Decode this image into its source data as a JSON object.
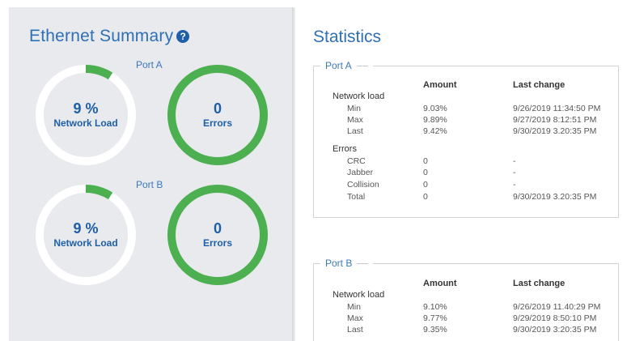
{
  "summary": {
    "title": "Ethernet Summary",
    "help_icon": "?",
    "ports": [
      {
        "label": "Port A",
        "load_value": "9 %",
        "load_caption": "Network Load",
        "load_fraction": 0.09,
        "errors_value": "0",
        "errors_caption": "Errors"
      },
      {
        "label": "Port B",
        "load_value": "9 %",
        "load_caption": "Network Load",
        "load_fraction": 0.09,
        "errors_value": "0",
        "errors_caption": "Errors"
      }
    ]
  },
  "statistics": {
    "title": "Statistics",
    "port_a": {
      "legend": "Port A",
      "col_amount": "Amount",
      "col_last_change": "Last change",
      "network_load": "Network load",
      "errors": "Errors",
      "load_rows": [
        {
          "label": "Min",
          "amount": "9.03%",
          "last": "9/26/2019 11:34:50 PM"
        },
        {
          "label": "Max",
          "amount": "9.89%",
          "last": "9/27/2019 8:12:51 PM"
        },
        {
          "label": "Last",
          "amount": "9.42%",
          "last": "9/30/2019 3.20:35 PM"
        }
      ],
      "error_rows": [
        {
          "label": "CRC",
          "amount": "0",
          "last": "-"
        },
        {
          "label": "Jabber",
          "amount": "0",
          "last": "-"
        },
        {
          "label": "Collision",
          "amount": "0",
          "last": "-"
        },
        {
          "label": "Total",
          "amount": "0",
          "last": "9/30/2019 3.20:35 PM"
        }
      ]
    },
    "port_b": {
      "legend": "Port B",
      "col_amount": "Amount",
      "col_last_change": "Last change",
      "network_load": "Network load",
      "load_rows": [
        {
          "label": "Min",
          "amount": "9.10%",
          "last": "9/26/2019 11.40:29 PM"
        },
        {
          "label": "Max",
          "amount": "9.77%",
          "last": "9/29/2019 8:50:10 PM"
        },
        {
          "label": "Last",
          "amount": "9.35%",
          "last": "9/30/2019 3:20:35 PM"
        }
      ]
    }
  },
  "colors": {
    "accent": "#2f6fb5",
    "ring_green": "#4caf50",
    "ring_track": "#ffffff"
  }
}
